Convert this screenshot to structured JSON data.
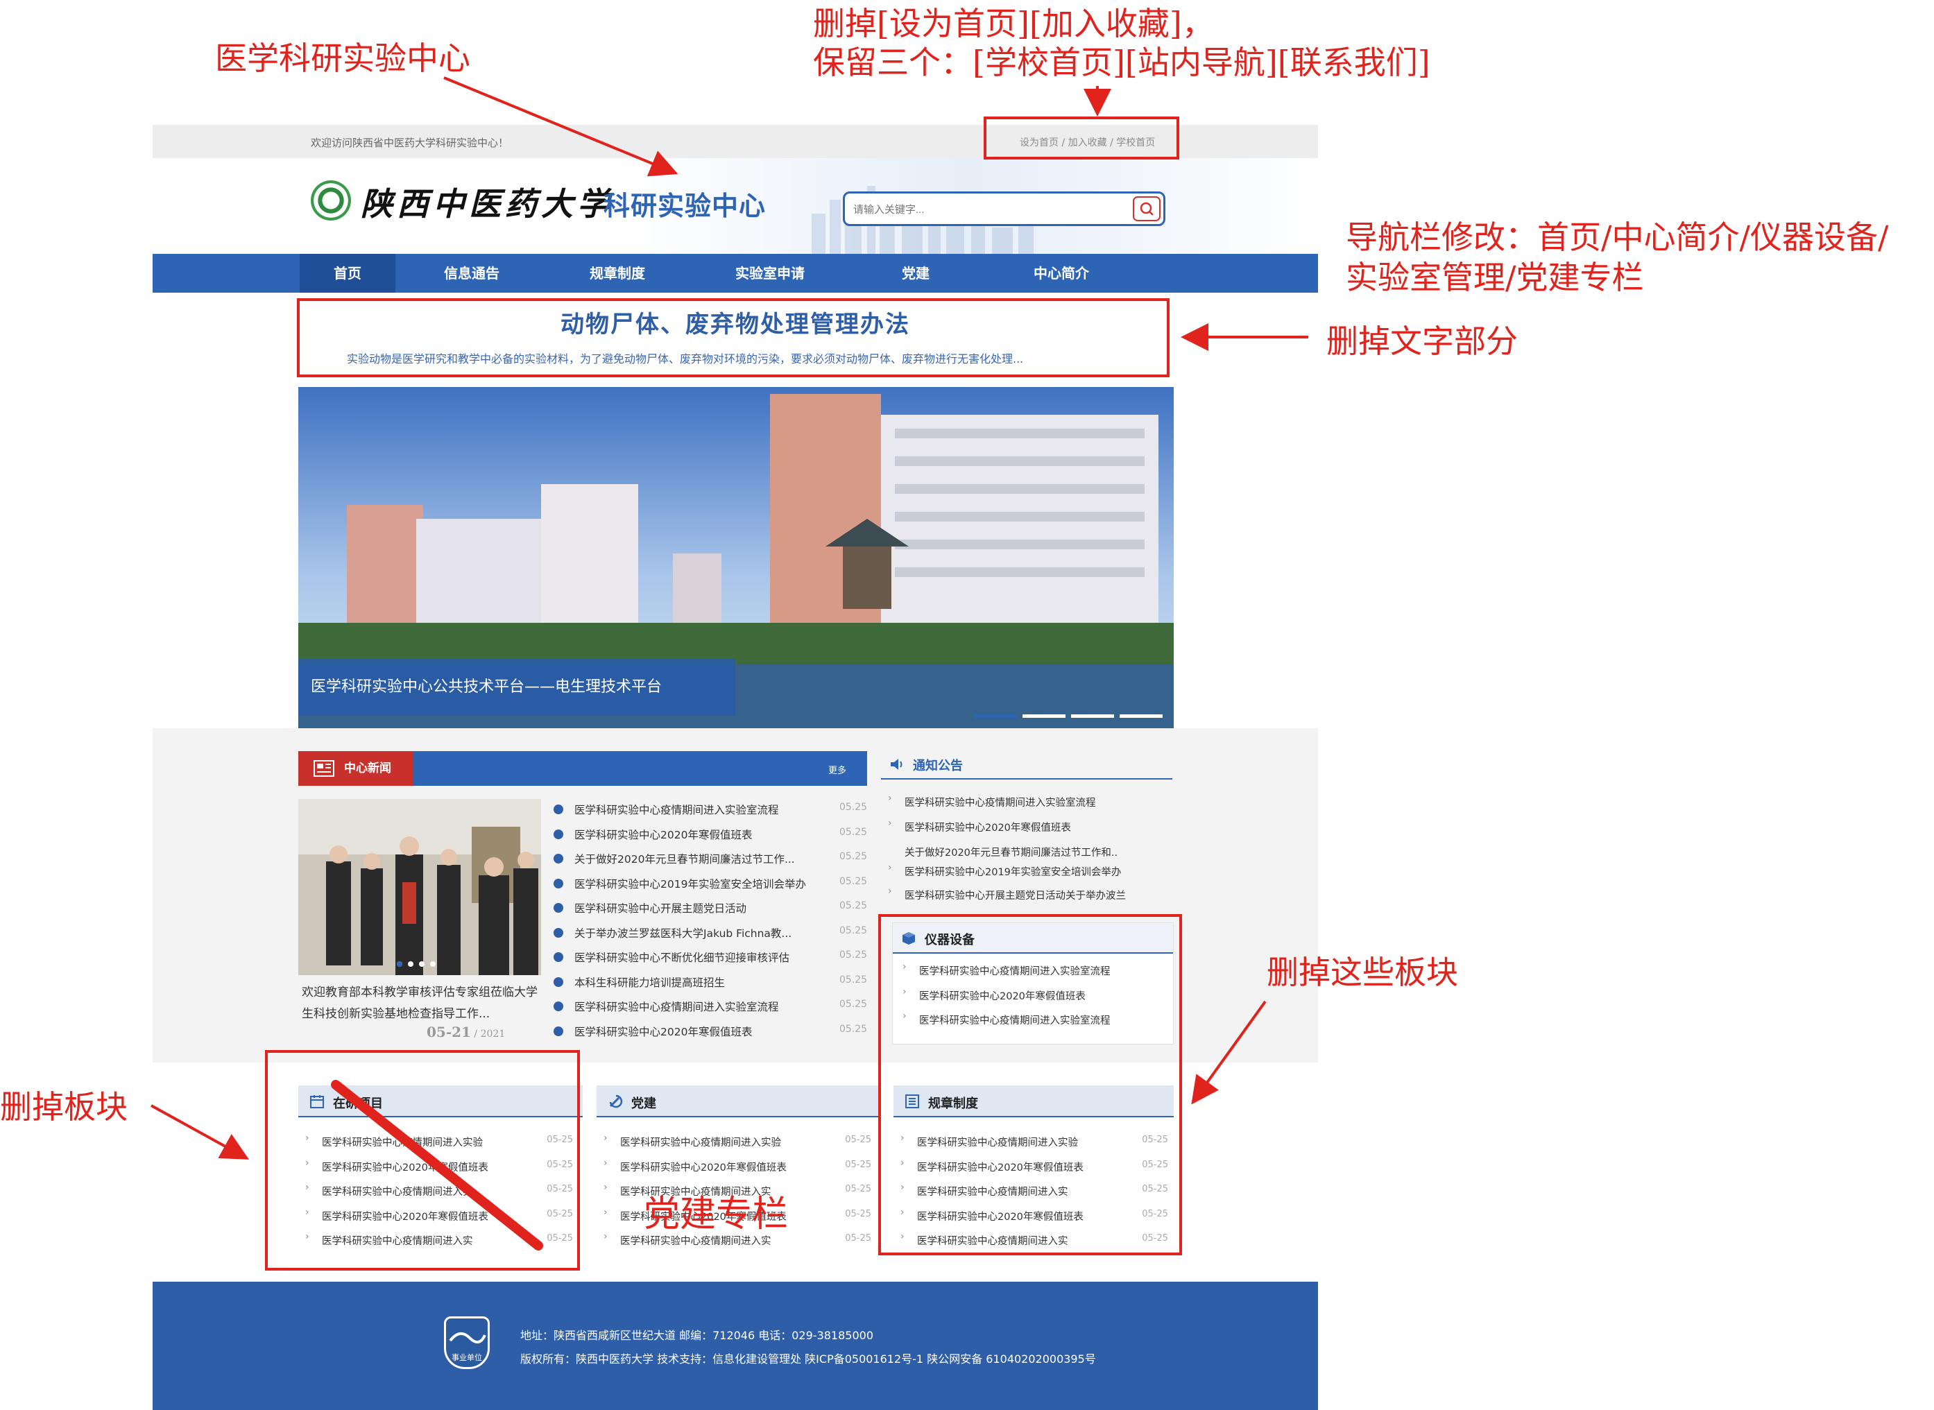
{
  "topbar": {
    "welcome": "欢迎访问陕西省中医药大学科研实验中心！",
    "links": [
      "设为首页",
      "加入收藏",
      "学校首页"
    ],
    "separator": " / "
  },
  "header": {
    "school_name": "陕西中医药大学",
    "site_name": "科研实验中心",
    "search_placeholder": "请输入关键字...",
    "search_icon": "search-icon"
  },
  "nav": {
    "items": [
      "首页",
      "信息通告",
      "规章制度",
      "实验室申请",
      "党建",
      "中心简介"
    ]
  },
  "headline": {
    "title": "动物尸体、废弃物处理管理办法",
    "desc": "实验动物是医学研究和教学中必备的实验材料，为了避免动物尸体、废弃物对环境的污染，要求必须对动物尸体、废弃物进行无害化处理..."
  },
  "banner": {
    "caption": "医学科研实验中心公共技术平台——电生理技术平台",
    "slides": 4,
    "active_slide": 1
  },
  "news": {
    "title": "中心新闻",
    "more": "更多",
    "photo_caption": "欢迎教育部本科教学审核评估专家组莅临大学生科技创新实验基地检查指导工作...",
    "photo_date_md": "05-21",
    "photo_date_sep": " / ",
    "photo_date_y": "2021",
    "items": [
      {
        "t": "医学科研实验中心疫情期间进入实验室流程",
        "d": "05.25"
      },
      {
        "t": "医学科研实验中心2020年寒假值班表",
        "d": "05.25"
      },
      {
        "t": "关于做好2020年元旦春节期间廉洁过节工作...",
        "d": "05.25"
      },
      {
        "t": "医学科研实验中心2019年实验室安全培训会举办",
        "d": "05.25"
      },
      {
        "t": "医学科研实验中心开展主题党日活动",
        "d": "05.25"
      },
      {
        "t": "关于举办波兰罗兹医科大学Jakub Fichna教...",
        "d": "05.25"
      },
      {
        "t": "医学科研实验中心不断优化细节迎接审核评估",
        "d": "05.25"
      },
      {
        "t": "本科生科研能力培训提高班招生",
        "d": "05.25"
      },
      {
        "t": "医学科研实验中心疫情期间进入实验室流程",
        "d": "05.25"
      },
      {
        "t": "医学科研实验中心2020年寒假值班表",
        "d": "05.25"
      }
    ]
  },
  "notice": {
    "title": "通知公告",
    "items": [
      "医学科研实验中心疫情期间进入实验室流程",
      "医学科研实验中心2020年寒假值班表",
      "关于做好2020年元旦春节期间廉洁过节工作和..",
      "医学科研实验中心2019年实验室安全培训会举办",
      "医学科研实验中心开展主题党日活动关于举办波兰"
    ]
  },
  "equipment": {
    "title": "仪器设备",
    "items": [
      "医学科研实验中心疫情期间进入实验室流程",
      "医学科研实验中心2020年寒假值班表",
      "医学科研实验中心疫情期间进入实验室流程"
    ]
  },
  "bottom_panels": [
    {
      "title": "在研项目",
      "items": [
        {
          "t": "医学科研实验中心疫情期间进入实验",
          "d": "05-25"
        },
        {
          "t": "医学科研实验中心2020年寒假值班表",
          "d": "05-25"
        },
        {
          "t": "医学科研实验中心疫情期间进入实",
          "d": "05-25"
        },
        {
          "t": "医学科研实验中心2020年寒假值班表",
          "d": "05-25"
        },
        {
          "t": "医学科研实验中心疫情期间进入实",
          "d": "05-25"
        }
      ]
    },
    {
      "title": "党建",
      "items": [
        {
          "t": "医学科研实验中心疫情期间进入实验",
          "d": "05-25"
        },
        {
          "t": "医学科研实验中心2020年寒假值班表",
          "d": "05-25"
        },
        {
          "t": "医学科研实验中心疫情期间进入实",
          "d": "05-25"
        },
        {
          "t": "医学科研实验中心2020年寒假值班表",
          "d": "05-25"
        },
        {
          "t": "医学科研实验中心疫情期间进入实",
          "d": "05-25"
        }
      ]
    },
    {
      "title": "规章制度",
      "items": [
        {
          "t": "医学科研实验中心疫情期间进入实验",
          "d": "05-25"
        },
        {
          "t": "医学科研实验中心2020年寒假值班表",
          "d": "05-25"
        },
        {
          "t": "医学科研实验中心疫情期间进入实",
          "d": "05-25"
        },
        {
          "t": "医学科研实验中心2020年寒假值班表",
          "d": "05-25"
        },
        {
          "t": "医学科研实验中心疫情期间进入实",
          "d": "05-25"
        }
      ]
    }
  ],
  "footer": {
    "badge_text": "事业单位",
    "address_line": "地址：陕西省西咸新区世纪大道 邮编：712046 电话：029-38185000",
    "copyright_line": "版权所有：陕西中医药大学 技术支持：信息化建设管理处 陕ICP备05001612号-1 陕公网安备 61040202000395号"
  },
  "annotations": {
    "center_name": "医学科研实验中心",
    "topbar_note_1": "删掉[设为首页][加入收藏]，",
    "topbar_note_2": "保留三个：[学校首页][站内导航][联系我们]",
    "nav_note_1": "导航栏修改：首页/中心简介/仪器设备/",
    "nav_note_2": "实验室管理/党建专栏",
    "headline_note": "删掉文字部分",
    "panels_note": "删掉这些板块",
    "project_note": "删掉板块",
    "party_note": "党建专栏"
  },
  "colors": {
    "brand_blue": "#2e64b4",
    "news_red": "#c8302c",
    "annotation_red": "#e0241d"
  }
}
